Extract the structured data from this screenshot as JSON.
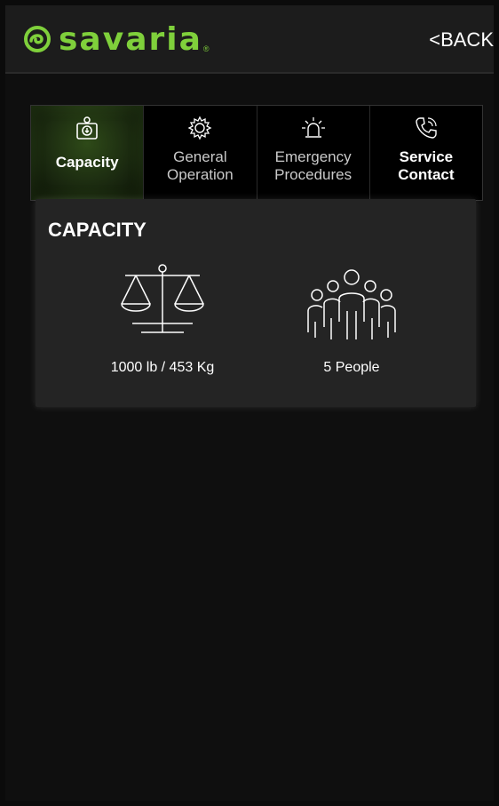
{
  "header": {
    "logo_text": "savaria",
    "logo_mark": "reg",
    "back_label": "<BACK",
    "brand_color": "#7fd03b"
  },
  "tabs": [
    {
      "label": "Capacity",
      "icon": "weight-icon",
      "active": true
    },
    {
      "label": "General\nOperation",
      "icon": "gear-icon",
      "active": false
    },
    {
      "label": "Emergency\nProcedures",
      "icon": "alarm-light-icon",
      "active": false
    },
    {
      "label": "Service\nContact",
      "icon": "phone-icon",
      "active": false
    }
  ],
  "capacity": {
    "title": "CAPACITY",
    "weight_label": "1000 lb / 453 Kg",
    "weight_icon": "scale-icon",
    "people_label": "5 People",
    "people_icon": "people-group-icon"
  }
}
